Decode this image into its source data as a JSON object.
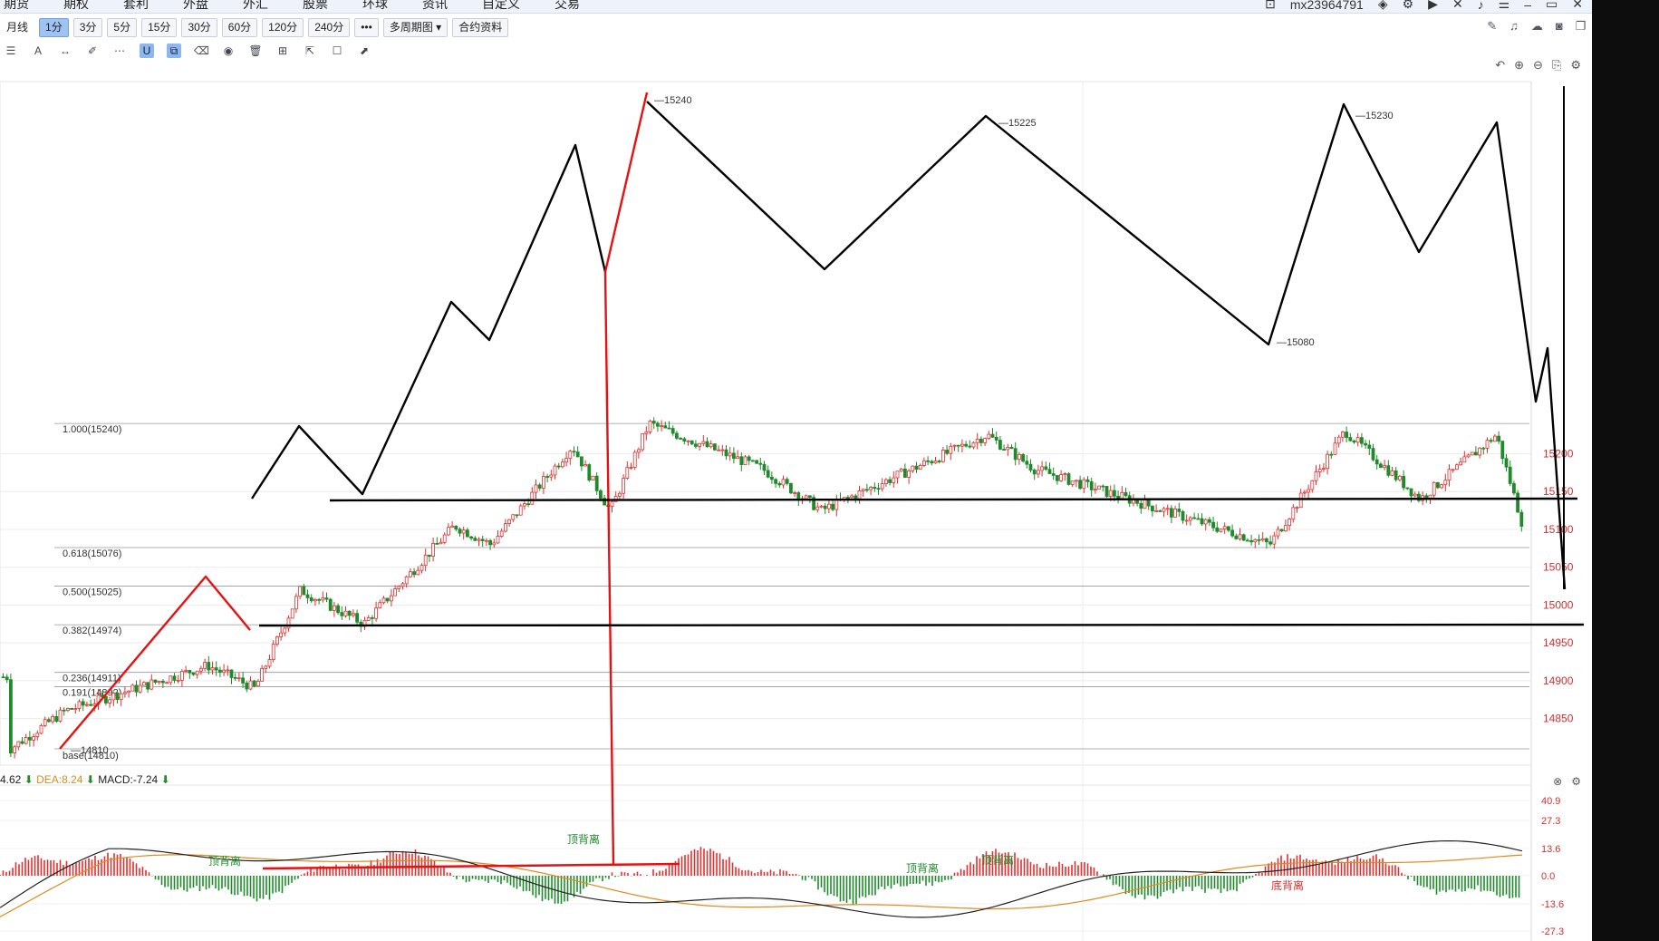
{
  "top_menu": [
    "期货",
    "期权",
    "套利",
    "外盘",
    "外汇",
    "股票",
    "环球",
    "资讯",
    "自定义",
    "交易"
  ],
  "account": "mx23964791",
  "periods": [
    "月线",
    "1分",
    "3分",
    "5分",
    "15分",
    "30分",
    "60分",
    "120分",
    "240分"
  ],
  "active_period": "1分",
  "more_label": "•••",
  "multi_period_label": "多周期图",
  "contract_info_label": "合约资料",
  "fib_levels": [
    {
      "label": "1.000(15240)",
      "price": 15240
    },
    {
      "label": "0.618(15076)",
      "price": 15076
    },
    {
      "label": "0.500(15025)",
      "price": 15025
    },
    {
      "label": "0.382(14974)",
      "price": 14974
    },
    {
      "label": "0.236(14911)",
      "price": 14911
    },
    {
      "label": "0.191(14892)",
      "price": 14892
    },
    {
      "label": "base(14810)",
      "price": 14810
    }
  ],
  "price_ticks": [
    "15200",
    "15150",
    "15100",
    "15050",
    "15000",
    "14950",
    "14900",
    "14850"
  ],
  "price_annotations": [
    "15240",
    "15225",
    "15230",
    "15080",
    "14810"
  ],
  "macd": {
    "dif_value": "4.62",
    "dea_label": "DEA:8.24",
    "macd_label": "MACD:-7.24",
    "ticks": [
      "40.9",
      "27.3",
      "13.6",
      "0.0",
      "-13.6",
      "-27.3"
    ],
    "divergence_top": "顶背离",
    "divergence_bottom": "底背离"
  },
  "colors": {
    "up": "#e03030",
    "down": "#1f8a2a",
    "dif_line": "#222222",
    "dea_line": "#e08a1e",
    "drawing_black": "#000000",
    "drawing_red": "#e81010"
  },
  "chart_data": {
    "type": "candlestick",
    "ylim": [
      14790,
      15270
    ],
    "sample_price_path": [
      14810,
      14860,
      14920,
      14890,
      15020,
      14975,
      15105,
      15080,
      15210,
      15125,
      15240,
      15180,
      15125,
      15225,
      15180,
      15080,
      15230,
      15140,
      15225,
      15040,
      15070,
      14905
    ]
  }
}
